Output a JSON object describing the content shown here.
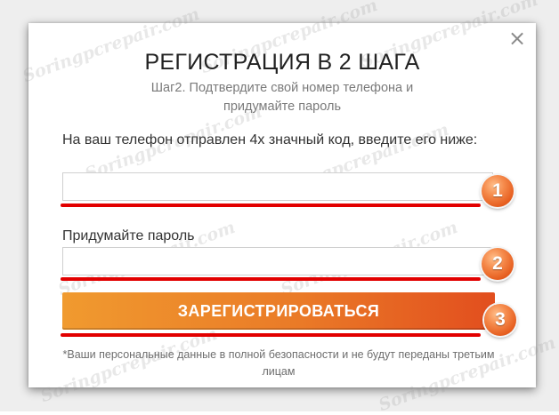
{
  "modal": {
    "close_glyph": "×",
    "title": "РЕГИСТРАЦИЯ В 2 ШАГА",
    "subtitle": "Шаг2. Подтвердите свой номер телефона и придумайте пароль"
  },
  "form": {
    "code_label": "На ваш телефон отправлен 4х значный код, введите его ниже:",
    "code_value": "",
    "password_label": "Придумайте пароль",
    "password_value": "",
    "submit_label": "ЗАРЕГИСТРИРОВАТЬСЯ",
    "privacy_note": "*Ваши персональные данные в полной безопасности и не будут переданы третьим лицам"
  },
  "annotations": {
    "badges": [
      "1",
      "2",
      "3"
    ],
    "highlight_color": "#e20000",
    "badge_color": "#e8662a"
  },
  "watermark": "Soringpcrepair.com",
  "colors": {
    "button_start": "#f09a2f",
    "button_end": "#e24e1e"
  }
}
